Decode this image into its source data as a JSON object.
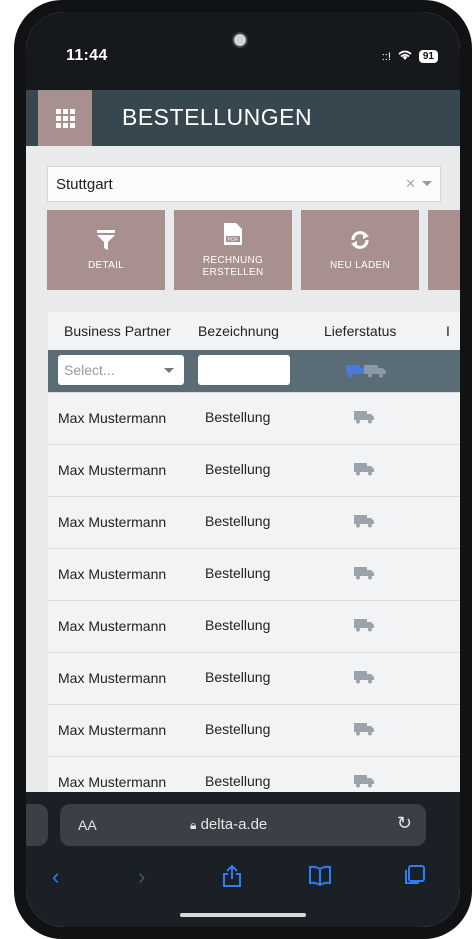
{
  "status_bar": {
    "time": "11:44",
    "signal": "::!",
    "battery": "91"
  },
  "app": {
    "title": "BESTELLUNGEN",
    "location_select": {
      "value": "Stuttgart"
    },
    "actions": [
      {
        "label": "DETAIL",
        "icon": "filter-icon"
      },
      {
        "label": "RECHNUNG\nERSTELLEN",
        "icon": "pdf-icon"
      },
      {
        "label": "NEU LADEN",
        "icon": "refresh-icon"
      }
    ]
  },
  "table": {
    "headers": [
      "Business Partner",
      "Bezeichnung",
      "Lieferstatus",
      "I"
    ],
    "filter": {
      "partner_placeholder": "Select..."
    },
    "rows": [
      {
        "partner": "Max Mustermann",
        "bezeichnung": "Bestellung"
      },
      {
        "partner": "Max Mustermann",
        "bezeichnung": "Bestellung"
      },
      {
        "partner": "Max Mustermann",
        "bezeichnung": "Bestellung"
      },
      {
        "partner": "Max Mustermann",
        "bezeichnung": "Bestellung"
      },
      {
        "partner": "Max Mustermann",
        "bezeichnung": "Bestellung"
      },
      {
        "partner": "Max Mustermann",
        "bezeichnung": "Bestellung"
      },
      {
        "partner": "Max Mustermann",
        "bezeichnung": "Bestellung"
      },
      {
        "partner": "Max Mustermann",
        "bezeichnung": "Bestellung"
      }
    ]
  },
  "browser": {
    "aa": "AA",
    "host": "delta-a.de"
  },
  "colors": {
    "appbar": "#37474f",
    "accent": "#a8908e",
    "filter_row": "#5a6d77",
    "link_blue": "#2e7cf6"
  }
}
